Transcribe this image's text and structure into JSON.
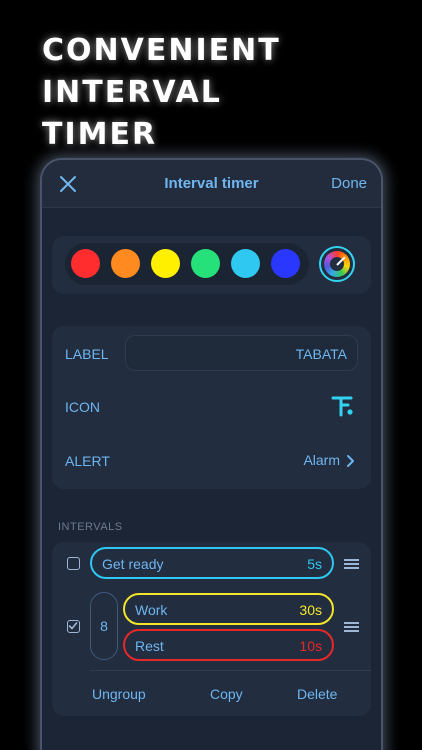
{
  "headline": {
    "line1": "CONVENIENT",
    "line2": "INTERVAL",
    "line3": "TIMER"
  },
  "navbar": {
    "title": "Interval timer",
    "done_label": "Done",
    "close_icon": "close-icon"
  },
  "colors": {
    "swatches": [
      "#ff2d2d",
      "#ff8a1f",
      "#fff000",
      "#26e07a",
      "#2ec8f0",
      "#2a38ff"
    ],
    "accent": "#6fb6f0",
    "picker_icon": "color-wheel-icon"
  },
  "settings": {
    "label_title": "LABEL",
    "label_value": "TABATA",
    "icon_title": "ICON",
    "icon_name": "tabata-figure-icon",
    "alert_title": "ALERT",
    "alert_value": "Alarm"
  },
  "intervals": {
    "section_title": "INTERVALS",
    "items": [
      {
        "name": "Get ready",
        "duration": "5s",
        "color": "#2ec8f0",
        "checked": false
      },
      {
        "name": "Work",
        "duration": "30s",
        "color": "#f5e52a",
        "checked": true
      },
      {
        "name": "Rest",
        "duration": "10s",
        "color": "#e62828",
        "checked": true
      }
    ],
    "repeat_count": "8",
    "actions": {
      "ungroup": "Ungroup",
      "copy": "Copy",
      "delete": "Delete"
    }
  }
}
